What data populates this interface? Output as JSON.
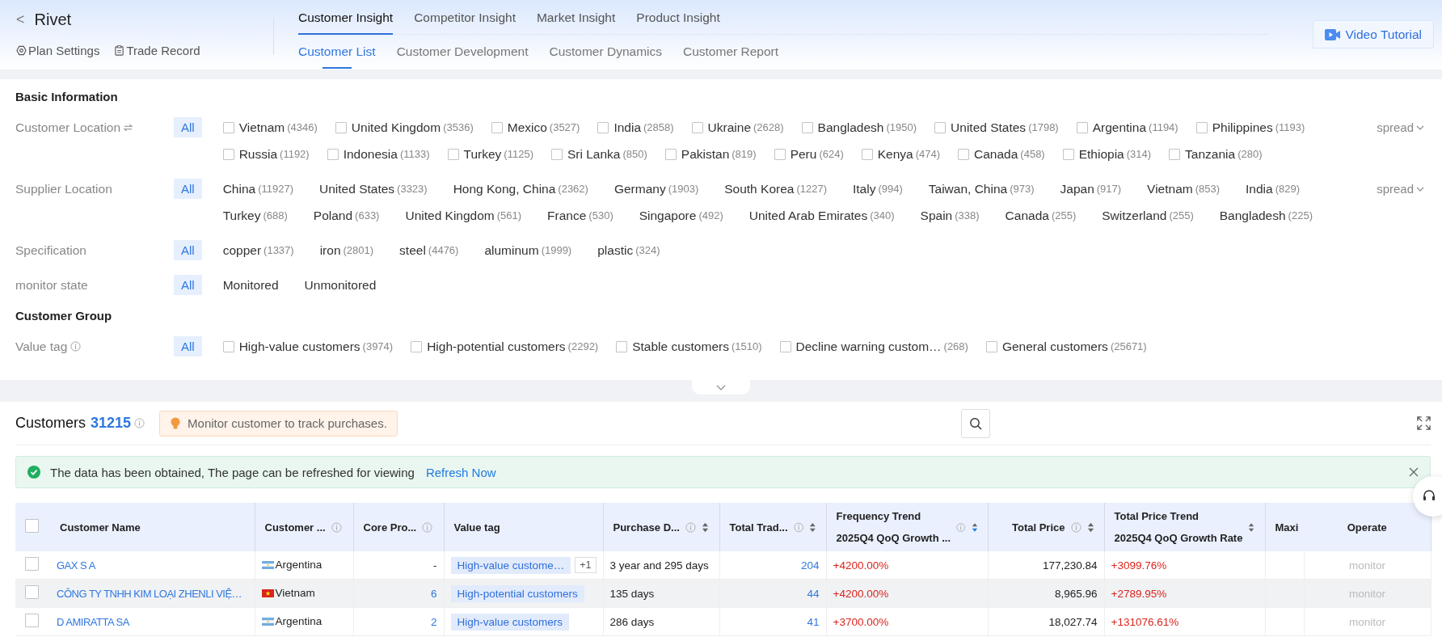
{
  "header": {
    "back": "<",
    "title": "Rivet",
    "links": [
      {
        "label": "Plan Settings"
      },
      {
        "label": "Trade Record"
      }
    ],
    "tabs": [
      {
        "label": "Customer Insight",
        "selected": true
      },
      {
        "label": "Competitor Insight",
        "selected": false
      },
      {
        "label": "Market Insight",
        "selected": false
      },
      {
        "label": "Product Insight",
        "selected": false
      }
    ],
    "subtabs": [
      {
        "label": "Customer List",
        "selected": true
      },
      {
        "label": "Customer Development",
        "selected": false
      },
      {
        "label": "Customer Dynamics",
        "selected": false
      },
      {
        "label": "Customer Report",
        "selected": false
      }
    ],
    "video_button": "Video Tutorial"
  },
  "filters": [
    {
      "kind": "heading",
      "title": "Basic Information"
    },
    {
      "kind": "checkbox",
      "label": "Customer Location",
      "all": "All",
      "all_selected": true,
      "more": "spread",
      "options": [
        {
          "label": "Vietnam",
          "count": "(4346)",
          "checked": false
        },
        {
          "label": "United Kingdom",
          "count": "(3536)",
          "checked": false
        },
        {
          "label": "Mexico",
          "count": "(3527)",
          "checked": false
        },
        {
          "label": "India",
          "count": "(2858)",
          "checked": false
        },
        {
          "label": "Ukraine",
          "count": "(2628)",
          "checked": false
        },
        {
          "label": "Bangladesh",
          "count": "(1950)",
          "checked": false
        },
        {
          "label": "United States",
          "count": "(1798)",
          "checked": false
        },
        {
          "label": "Argentina",
          "count": "(1194)",
          "checked": false
        },
        {
          "label": "Philippines",
          "count": "(1193)",
          "checked": false
        },
        {
          "label": "Russia",
          "count": "(1192)",
          "checked": false
        },
        {
          "label": "Indonesia",
          "count": "(1133)",
          "checked": false
        },
        {
          "label": "Turkey",
          "count": "(1125)",
          "checked": false
        },
        {
          "label": "Sri Lanka",
          "count": "(850)",
          "checked": false
        },
        {
          "label": "Pakistan",
          "count": "(819)",
          "checked": false
        },
        {
          "label": "Peru",
          "count": "(624)",
          "checked": false
        },
        {
          "label": "Kenya",
          "count": "(474)",
          "checked": false
        },
        {
          "label": "Canada",
          "count": "(458)",
          "checked": false
        },
        {
          "label": "Ethiopia",
          "count": "(314)",
          "checked": false
        },
        {
          "label": "Tanzania",
          "count": "(280)",
          "checked": false
        }
      ]
    },
    {
      "kind": "plain",
      "label": "Supplier Location",
      "all": "All",
      "all_selected": true,
      "more": "spread",
      "options": [
        {
          "label": "China",
          "count": "(11927)",
          "selected": false
        },
        {
          "label": "United States",
          "count": "(3323)",
          "selected": false
        },
        {
          "label": "Hong Kong, China",
          "count": "(2362)",
          "selected": false
        },
        {
          "label": "Germany",
          "count": "(1903)",
          "selected": false
        },
        {
          "label": "South Korea",
          "count": "(1227)",
          "selected": false
        },
        {
          "label": "Italy",
          "count": "(994)",
          "selected": false
        },
        {
          "label": "Taiwan, China",
          "count": "(973)",
          "selected": false
        },
        {
          "label": "Japan",
          "count": "(917)",
          "selected": false
        },
        {
          "label": "Vietnam",
          "count": "(853)",
          "selected": false
        },
        {
          "label": "India",
          "count": "(829)",
          "selected": false
        },
        {
          "label": "Turkey",
          "count": "(688)",
          "selected": false
        },
        {
          "label": "Poland",
          "count": "(633)",
          "selected": false
        },
        {
          "label": "United Kingdom",
          "count": "(561)",
          "selected": false
        },
        {
          "label": "France",
          "count": "(530)",
          "selected": false
        },
        {
          "label": "Singapore",
          "count": "(492)",
          "selected": false
        },
        {
          "label": "United Arab Emirates",
          "count": "(340)",
          "selected": false
        },
        {
          "label": "Spain",
          "count": "(338)",
          "selected": false
        },
        {
          "label": "Canada",
          "count": "(255)",
          "selected": false
        },
        {
          "label": "Switzerland",
          "count": "(255)",
          "selected": false
        },
        {
          "label": "Bangladesh",
          "count": "(225)",
          "selected": false
        }
      ]
    },
    {
      "kind": "plain",
      "label": "Specification",
      "all": "All",
      "all_selected": true,
      "options": [
        {
          "label": "copper",
          "count": "(1337)",
          "selected": false
        },
        {
          "label": "iron",
          "count": "(2801)",
          "selected": false
        },
        {
          "label": "steel",
          "count": "(4476)",
          "selected": false
        },
        {
          "label": "aluminum",
          "count": "(1999)",
          "selected": false
        },
        {
          "label": "plastic",
          "count": "(324)",
          "selected": false
        }
      ]
    },
    {
      "kind": "plain",
      "label": "monitor state",
      "all": "All",
      "all_selected": true,
      "options": [
        {
          "label": "Monitored",
          "selected": false
        },
        {
          "label": "Unmonitored",
          "selected": false
        }
      ]
    },
    {
      "kind": "heading",
      "title": "Customer Group"
    },
    {
      "kind": "checkbox",
      "label": "Value tag",
      "all": "All",
      "all_selected": true,
      "options": [
        {
          "label": "High-value customers",
          "count": "(3974)",
          "checked": false
        },
        {
          "label": "High-potential customers",
          "count": "(2292)",
          "checked": false
        },
        {
          "label": "Stable customers",
          "count": "(1510)",
          "checked": false
        },
        {
          "label": "Decline warning custom…",
          "count": "(268)",
          "checked": false
        },
        {
          "label": "General customers",
          "count": "(25671)",
          "checked": false
        }
      ]
    }
  ],
  "customers": {
    "title": "Customers",
    "count": "31215",
    "hint": "Monitor customer to track purchases.",
    "alert": {
      "message": "The data has been obtained, The page can be refreshed for viewing",
      "link": "Refresh Now"
    },
    "table": {
      "header_checked": false,
      "columns": [
        {
          "label": "Customer Name"
        },
        {
          "label": "Customer ...",
          "info": true
        },
        {
          "label": "Core Pro...",
          "info": true
        },
        {
          "label": "Value tag"
        },
        {
          "label": "Purchase D...",
          "info": true,
          "sortable": true,
          "sort_desc": false
        },
        {
          "label": "Total Trad...",
          "info": true,
          "sortable": true,
          "sort_desc": false
        },
        {
          "label": "Frequency Trend",
          "sublabel": "2025Q4 QoQ Growth ...",
          "info": true,
          "sortable": true,
          "sort_desc": true
        },
        {
          "label": "Total Price",
          "info": true,
          "sortable": true,
          "sort_desc": false
        },
        {
          "label": "Total Price Trend",
          "sublabel": "2025Q4 QoQ Growth Rate",
          "sortable": true,
          "sort_desc": false
        },
        {
          "label": "Maxi"
        },
        {
          "label": "Operate"
        }
      ],
      "rows": [
        {
          "checked": false,
          "highlighted": false,
          "name": "GAX S A",
          "kind": "argentina",
          "country": "Argentina",
          "core": {
            "text": "-",
            "link": false
          },
          "tags": [
            "High-value custome…"
          ],
          "more_tags": "+1",
          "purchase": "3 year and 295 days",
          "trades": "204",
          "freq": "+4200.00%",
          "price": "177,230.84",
          "price_trend": "+3099.76%",
          "action": {
            "label": "monitor",
            "disabled": true
          }
        },
        {
          "checked": false,
          "highlighted": true,
          "name": "CÔNG TY TNHH KIM LOẠI ZHENLI VIỆ…",
          "kind": "vietnam",
          "country": "Vietnam",
          "core": {
            "text": "6",
            "link": true
          },
          "tags": [
            "High-potential customers"
          ],
          "purchase": "135 days",
          "trades": "44",
          "freq": "+4200.00%",
          "price": "8,965.96",
          "price_trend": "+2789.95%",
          "action": {
            "label": "monitor",
            "disabled": true
          }
        },
        {
          "checked": false,
          "highlighted": false,
          "name": "D AMIRATTA SA",
          "kind": "argentina",
          "country": "Argentina",
          "core": {
            "text": "2",
            "link": true
          },
          "tags": [
            "High-value customers"
          ],
          "purchase": "286 days",
          "trades": "41",
          "freq": "+3700.00%",
          "price": "18,027.74",
          "price_trend": "+131076.61%",
          "action": {
            "label": "monitor",
            "disabled": true
          }
        }
      ]
    }
  }
}
